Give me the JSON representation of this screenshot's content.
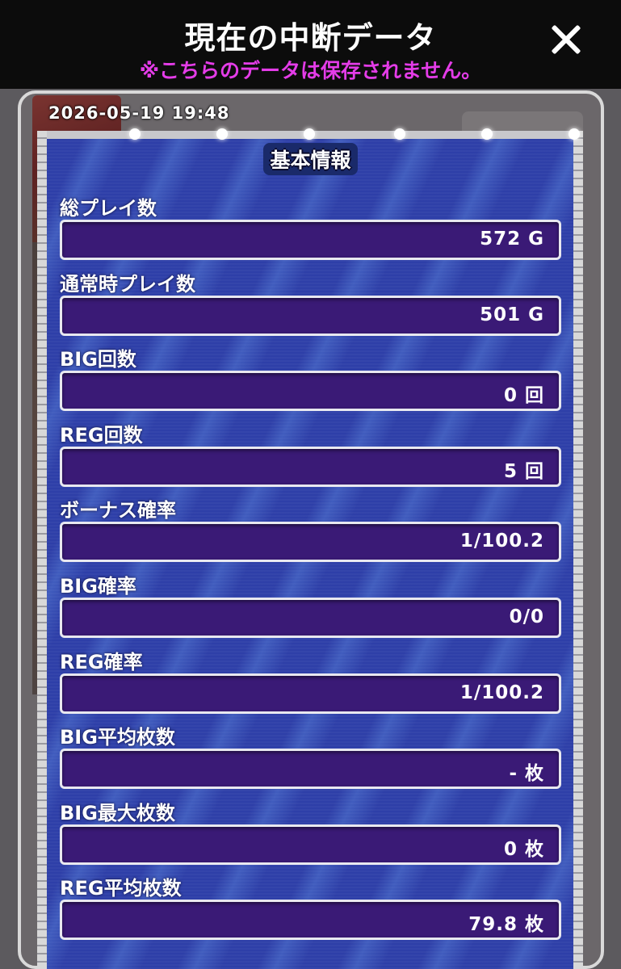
{
  "header": {
    "title": "現在の中断データ",
    "notice": "※こちらのデータは保存されません。"
  },
  "timestamp": "2026-05-19 19:48",
  "section_title": "基本情報",
  "rows": [
    {
      "label": "総プレイ数",
      "value": "572 G"
    },
    {
      "label": "通常時プレイ数",
      "value": "501 G"
    },
    {
      "label": "BIG回数",
      "value": "0 回"
    },
    {
      "label": "REG回数",
      "value": "5 回"
    },
    {
      "label": "ボーナス確率",
      "value": "1/100.2"
    },
    {
      "label": "BIG確率",
      "value": "0/0"
    },
    {
      "label": "REG確率",
      "value": "1/100.2"
    },
    {
      "label": "BIG平均枚数",
      "value": "- 枚"
    },
    {
      "label": "BIG最大枚数",
      "value": "0 枚"
    },
    {
      "label": "REG平均枚数",
      "value": "79.8 枚"
    }
  ],
  "colors": {
    "notice": "#e43ce8",
    "panel_bg": "#2e3fa8",
    "value_box": "#3a1a76"
  },
  "icons": {
    "close": "close-icon"
  }
}
